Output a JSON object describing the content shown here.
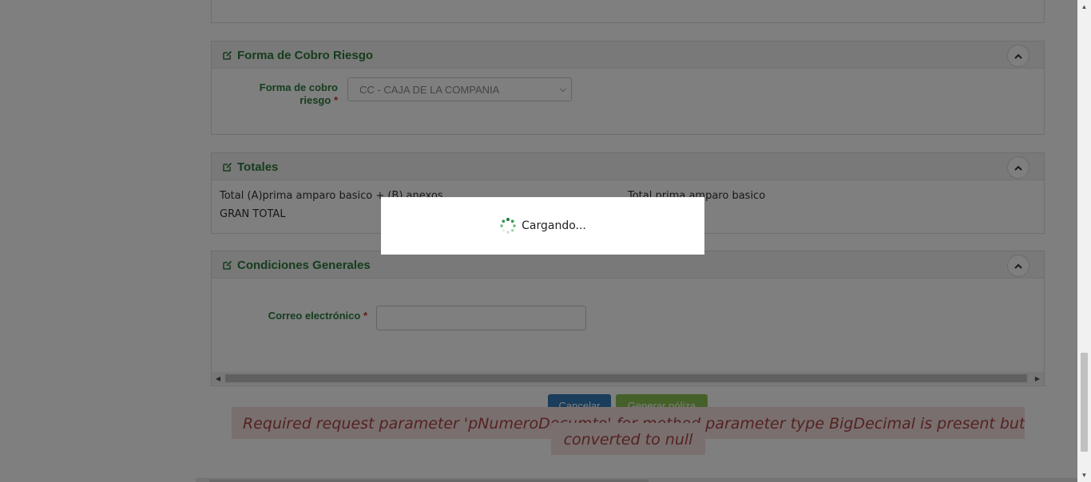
{
  "sections": {
    "forma_cobro": {
      "title": "Forma de Cobro Riesgo",
      "label_line1": "Forma de cobro",
      "label_line2": "riesgo",
      "required_mark": "*",
      "select_value": "CC - CAJA DE LA COMPANIA"
    },
    "totales": {
      "title": "Totales",
      "total_a_b": "Total (A)prima amparo basico + (B) anexos",
      "total_prima": "Total prima amparo basico",
      "gran_total": "GRAN TOTAL"
    },
    "condiciones": {
      "title": "Condiciones Generales",
      "email_label": "Correo electrónico",
      "required_mark": "*",
      "email_value": ""
    }
  },
  "buttons": {
    "cancel": "Cancelar",
    "generate": "Generar póliza"
  },
  "error": {
    "line1": "Required request parameter 'pNumeroDocumto' for method parameter type BigDecimal is present but",
    "line2": "converted to null"
  },
  "loading": {
    "text": "Cargando..."
  },
  "colors": {
    "accent_green": "#2a7a3a",
    "cancel_blue": "#337ab7",
    "generate_green": "#8cc152",
    "error_bg": "#f2dede",
    "error_text": "#a94442"
  },
  "icons": {
    "edit": "edit-icon",
    "collapse": "chevron-up-icon",
    "spinner": "spinner-icon"
  }
}
